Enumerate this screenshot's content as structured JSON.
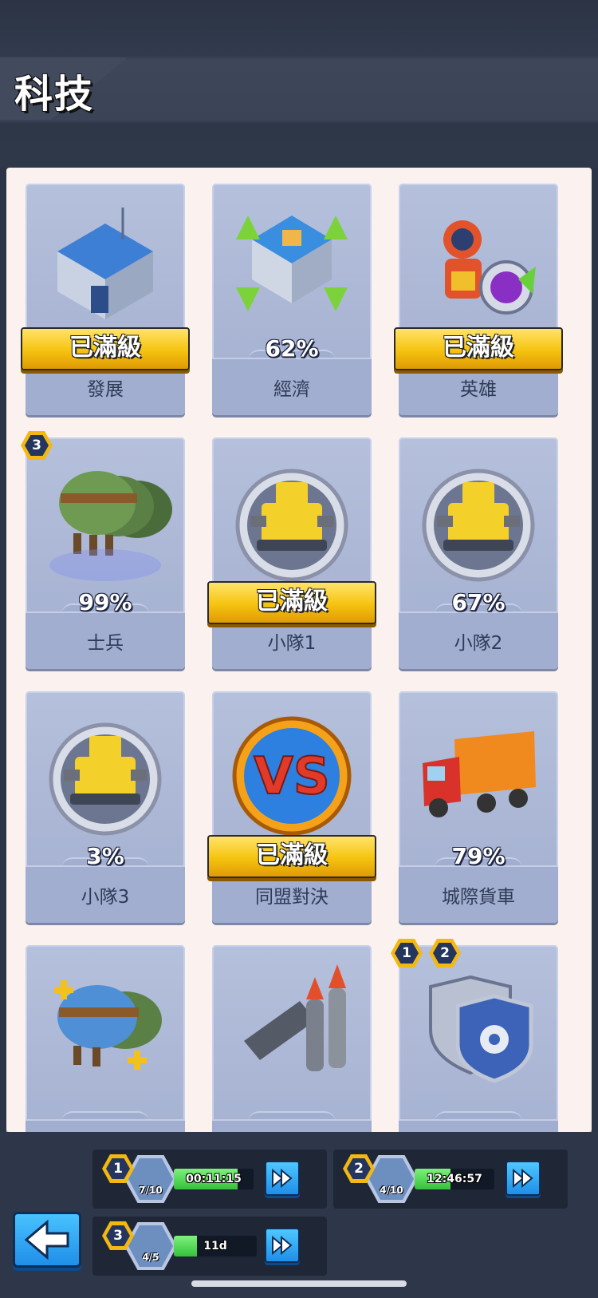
{
  "header": {
    "title": "科技"
  },
  "cards": [
    {
      "name": "發展",
      "status": "已滿級",
      "icon": "headquarters-building-icon"
    },
    {
      "name": "經濟",
      "status": "62%",
      "icon": "economy-building-icon"
    },
    {
      "name": "英雄",
      "status": "已滿級",
      "icon": "hero-icon"
    },
    {
      "name": "士兵",
      "status": "99%",
      "badge": "3",
      "icon": "soldier-helmets-icon"
    },
    {
      "name": "小隊1",
      "status": "已滿級",
      "icon": "squad-tank-icon"
    },
    {
      "name": "小隊2",
      "status": "67%",
      "icon": "squad-tank-icon"
    },
    {
      "name": "小隊3",
      "status": "3%",
      "icon": "squad-tank-icon"
    },
    {
      "name": "同盟對決",
      "status": "已滿級",
      "icon": "vs-icon"
    },
    {
      "name": "城際貨車",
      "status": "79%",
      "icon": "truck-icon"
    },
    {
      "name": "",
      "status": "",
      "icon": "helmets-plus-icon"
    },
    {
      "name": "",
      "status": "",
      "icon": "missiles-icon"
    },
    {
      "name": "",
      "status": "",
      "badges": [
        "1",
        "2"
      ],
      "icon": "shields-icon"
    }
  ],
  "queues": [
    {
      "slot": "1",
      "count": "7/10",
      "timer": "00:11:15",
      "progress": 0.8
    },
    {
      "slot": "2",
      "count": "4/10",
      "timer": "12:46:57",
      "progress": 0.45
    },
    {
      "slot": "3",
      "count": "4/5",
      "timer": "11d 00:46:08",
      "progress": 0.28
    }
  ],
  "colors": {
    "accent_gold": "#f5c30f",
    "button_blue": "#1f8fe8",
    "progress_green": "#35c23a"
  }
}
